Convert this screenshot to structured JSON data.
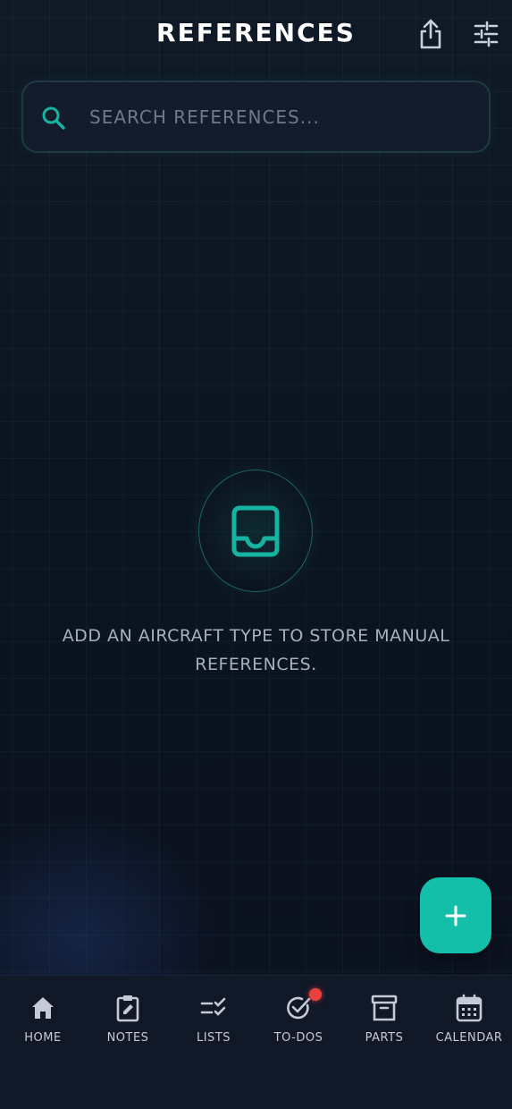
{
  "header": {
    "title": "REFERENCES",
    "share_icon": "share-icon",
    "filter_icon": "sliders-icon"
  },
  "search": {
    "placeholder": "SEARCH REFERENCES...",
    "value": "",
    "icon": "search-icon"
  },
  "empty_state": {
    "icon": "inbox-tray-icon",
    "message": "ADD AN AIRCRAFT TYPE TO STORE MANUAL REFERENCES."
  },
  "fab": {
    "icon": "plus-icon"
  },
  "nav": {
    "items": [
      {
        "label": "HOME",
        "icon": "home-icon"
      },
      {
        "label": "NOTES",
        "icon": "clipboard-edit-icon"
      },
      {
        "label": "LISTS",
        "icon": "checklist-icon"
      },
      {
        "label": "TO-DOS",
        "icon": "check-circle-icon",
        "badge": true
      },
      {
        "label": "PARTS",
        "icon": "archive-box-icon"
      },
      {
        "label": "CALENDAR",
        "icon": "calendar-icon"
      }
    ]
  },
  "colors": {
    "accent": "#14bfa9",
    "background": "#0c1220",
    "badge": "#e8413c",
    "nav_background": "#111827"
  }
}
